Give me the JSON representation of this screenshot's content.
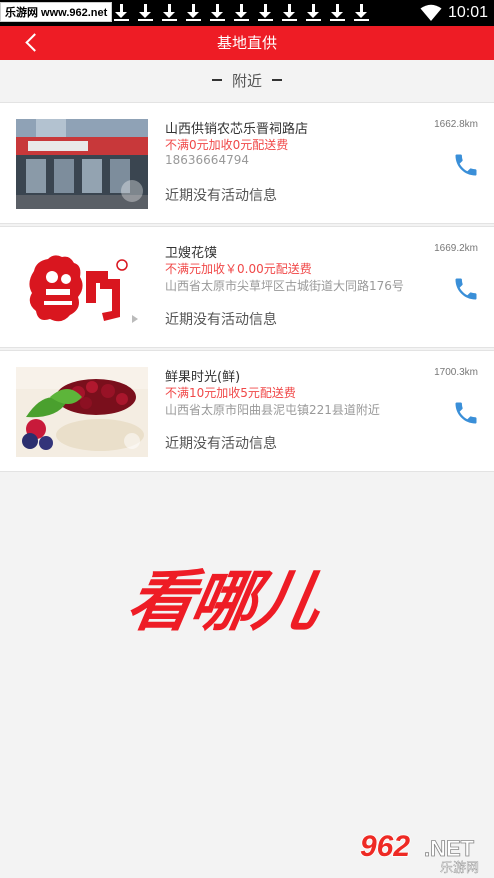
{
  "status_bar": {
    "watermark": "乐游网 www.962.net",
    "time": "10:01",
    "download_icon_count": 11
  },
  "header": {
    "back_icon": "chevron-left-icon",
    "title": "基地直供"
  },
  "section": {
    "label": "附近"
  },
  "stores": [
    {
      "name": "山西供销农芯乐晋祠路店",
      "distance": "1662.8km",
      "promo": "不满0元加收0元配送费",
      "phone_or_address": "18636664794",
      "activity": "近期没有活动信息",
      "thumb": "storefront-photo"
    },
    {
      "name": "卫嫂花馍",
      "distance": "1669.2km",
      "promo": "不满元加收￥0.00元配送费",
      "phone_or_address": "山西省太原市尖草坪区古城街道大同路176号",
      "activity": "近期没有活动信息",
      "thumb": "weisao-logo"
    },
    {
      "name": "鲜果时光(鲜)",
      "distance": "1700.3km",
      "promo": "不满10元加收5元配送费",
      "phone_or_address": "山西省太原市阳曲县泥屯镇221县道附近",
      "activity": "近期没有活动信息",
      "thumb": "fruit-photo"
    }
  ],
  "watermark_text": "看哪儿",
  "footer_logo": {
    "number": "962",
    "suffix": ".NET",
    "caption": "乐游网"
  },
  "colors": {
    "accent": "#ee1c25",
    "promo": "#f04848",
    "phone": "#3a8fd8"
  }
}
